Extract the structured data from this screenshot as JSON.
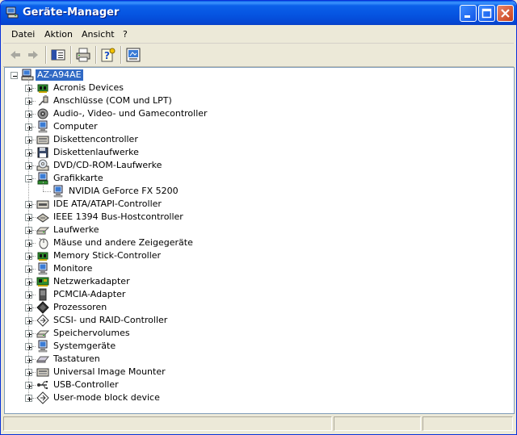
{
  "window": {
    "title": "Geräte-Manager"
  },
  "menu": {
    "items": [
      "Datei",
      "Aktion",
      "Ansicht",
      "?"
    ]
  },
  "toolbar": {
    "buttons": [
      "back-icon",
      "forward-icon",
      "show-hide-tree-icon",
      "print-icon",
      "help-icon",
      "properties-icon"
    ]
  },
  "tree": {
    "root": "AZ-A94AE",
    "categories": [
      {
        "label": "Acronis Devices",
        "icon": "chip-icon",
        "expanded": false
      },
      {
        "label": "Anschlüsse (COM und LPT)",
        "icon": "port-icon",
        "expanded": false
      },
      {
        "label": "Audio-, Video- und Gamecontroller",
        "icon": "speaker-icon",
        "expanded": false
      },
      {
        "label": "Computer",
        "icon": "monitor-icon",
        "expanded": false
      },
      {
        "label": "Diskettencontroller",
        "icon": "controller-icon",
        "expanded": false
      },
      {
        "label": "Diskettenlaufwerke",
        "icon": "floppy-icon",
        "expanded": false
      },
      {
        "label": "DVD/CD-ROM-Laufwerke",
        "icon": "cd-icon",
        "expanded": false
      },
      {
        "label": "Grafikkarte",
        "icon": "display-adapter-icon",
        "expanded": true,
        "children": [
          "NVIDIA GeForce FX 5200"
        ]
      },
      {
        "label": "IDE ATA/ATAPI-Controller",
        "icon": "ide-icon",
        "expanded": false
      },
      {
        "label": "IEEE 1394 Bus-Hostcontroller",
        "icon": "firewire-icon",
        "expanded": false
      },
      {
        "label": "Laufwerke",
        "icon": "drive-icon",
        "expanded": false
      },
      {
        "label": "Mäuse und andere Zeigegeräte",
        "icon": "mouse-icon",
        "expanded": false
      },
      {
        "label": "Memory Stick-Controller",
        "icon": "chip-icon",
        "expanded": false
      },
      {
        "label": "Monitore",
        "icon": "monitor-icon",
        "expanded": false
      },
      {
        "label": "Netzwerkadapter",
        "icon": "network-card-icon",
        "expanded": false
      },
      {
        "label": "PCMCIA-Adapter",
        "icon": "pcmcia-icon",
        "expanded": false
      },
      {
        "label": "Prozessoren",
        "icon": "cpu-icon",
        "expanded": false
      },
      {
        "label": "SCSI- und RAID-Controller",
        "icon": "scsi-icon",
        "expanded": false
      },
      {
        "label": "Speichervolumes",
        "icon": "drive-icon",
        "expanded": false
      },
      {
        "label": "Systemgeräte",
        "icon": "monitor-icon",
        "expanded": false
      },
      {
        "label": "Tastaturen",
        "icon": "keyboard-icon",
        "expanded": false
      },
      {
        "label": "Universal Image Mounter",
        "icon": "controller-icon",
        "expanded": false
      },
      {
        "label": "USB-Controller",
        "icon": "usb-icon",
        "expanded": false
      },
      {
        "label": "User-mode block device",
        "icon": "scsi-icon",
        "expanded": false
      }
    ]
  },
  "colors": {
    "titlebar": "#0553e0",
    "selection": "#316ac5",
    "face": "#ece9d8"
  }
}
